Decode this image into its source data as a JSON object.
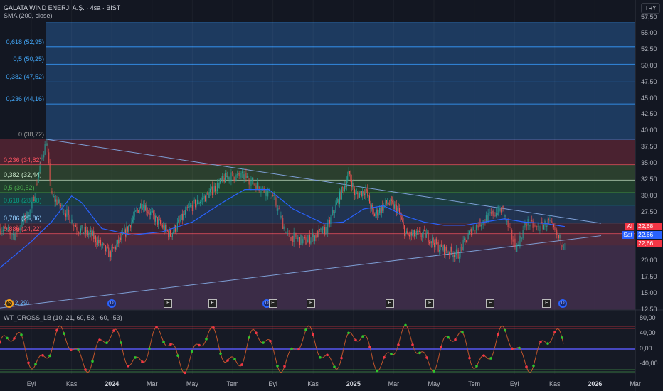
{
  "header": {
    "title": "GALATA WIND ENERJİ A.Ş. · 4sa · BIST",
    "indicator": "SMA (200, close)",
    "currency": "TRY"
  },
  "oscillator": {
    "title": "WT_CROSS_LB (10, 21, 60, 53, -60, -53)",
    "ticks": [
      "80,00",
      "40,00",
      "0,00",
      "-40,00"
    ]
  },
  "price_axis": [
    "57,50",
    "55,00",
    "52,50",
    "50,00",
    "47,50",
    "45,00",
    "42,50",
    "40,00",
    "37,50",
    "35,00",
    "32,50",
    "30,00",
    "27,50",
    "20,00",
    "17,50",
    "15,00",
    "12,50"
  ],
  "price_tags": {
    "buy_label": "Al",
    "buy": "22,68",
    "sell_label": "Sat",
    "sell": "22,66",
    "last": "22,66"
  },
  "time_axis": [
    "Eyl",
    "Kas",
    "2024",
    "Mar",
    "May",
    "Tem",
    "Eyl",
    "Kas",
    "2025",
    "Mar",
    "May",
    "Tem",
    "Eyl",
    "Kas",
    "2026",
    "Mar"
  ],
  "fib_upper": [
    {
      "label": "0,618 (52,95)",
      "v": 52.95
    },
    {
      "label": "0,5 (50,25)",
      "v": 50.25
    },
    {
      "label": "0,382 (47,52)",
      "v": 47.52
    },
    {
      "label": "0,236 (44,16)",
      "v": 44.16
    },
    {
      "label": "0 (38,72)",
      "v": 38.72
    }
  ],
  "fib_lower": [
    {
      "label": "0,236 (34,82)",
      "v": 34.82,
      "c": "#f7525f"
    },
    {
      "label": "0,382 (32,44)",
      "v": 32.44,
      "c": "#c8e6c9"
    },
    {
      "label": "0,5 (30,52)",
      "v": 30.52,
      "c": "#4caf50"
    },
    {
      "label": "0,618 (28,58)",
      "v": 28.58,
      "c": "#089981"
    },
    {
      "label": "0,786 (25,86)",
      "v": 25.86,
      "c": "#90caf9"
    },
    {
      "label": "0,886 (24,22)",
      "v": 24.22,
      "c": "#f7525f"
    },
    {
      "label": "1 (12,29)",
      "v": 12.29,
      "c": "#64b5f6"
    }
  ],
  "events": [
    {
      "t": "S",
      "m": -1.1
    },
    {
      "t": "D",
      "m": 4
    },
    {
      "t": "E",
      "m": 6.8
    },
    {
      "t": "E",
      "m": 9
    },
    {
      "t": "D",
      "m": 11.7
    },
    {
      "t": "E",
      "m": 12
    },
    {
      "t": "E",
      "m": 13.9
    },
    {
      "t": "E",
      "m": 17.8
    },
    {
      "t": "E",
      "m": 19.8
    },
    {
      "t": "E",
      "m": 22.8
    },
    {
      "t": "E",
      "m": 25.6
    },
    {
      "t": "D",
      "m": 26.4
    }
  ],
  "chart_data": {
    "type": "line",
    "title": "GALATA WIND ENERJİ A.Ş. 4sa",
    "x_unit": "months from Sep 2023",
    "ylim": [
      12.5,
      57.5
    ],
    "price": [
      [
        -1.55,
        25
      ],
      [
        -0.85,
        24
      ],
      [
        0,
        28
      ],
      [
        0.4,
        34
      ],
      [
        0.75,
        38.7
      ],
      [
        1,
        30
      ],
      [
        1.6,
        28
      ],
      [
        2.3,
        25
      ],
      [
        3,
        24
      ],
      [
        3.9,
        21
      ],
      [
        4.6,
        24
      ],
      [
        5.5,
        29
      ],
      [
        6,
        27
      ],
      [
        6.9,
        24
      ],
      [
        7.8,
        28
      ],
      [
        8.7,
        30
      ],
      [
        9.7,
        33
      ],
      [
        10.6,
        33
      ],
      [
        11.5,
        31
      ],
      [
        12,
        30
      ],
      [
        12.7,
        24
      ],
      [
        13.6,
        23
      ],
      [
        14.7,
        25
      ],
      [
        15.2,
        29
      ],
      [
        15.8,
        33.5
      ],
      [
        16.1,
        30
      ],
      [
        16.6,
        31
      ],
      [
        17,
        27
      ],
      [
        17.7,
        29
      ],
      [
        18.2,
        28
      ],
      [
        18.6,
        24
      ],
      [
        19.6,
        24
      ],
      [
        20.3,
        22
      ],
      [
        21.2,
        21
      ],
      [
        21.9,
        25
      ],
      [
        22.8,
        27
      ],
      [
        23.4,
        28
      ],
      [
        23.7,
        25
      ],
      [
        24.1,
        22
      ],
      [
        24.6,
        26
      ],
      [
        25.1,
        25
      ],
      [
        25.7,
        26
      ],
      [
        26.2,
        23.5
      ],
      [
        26.5,
        22.66
      ]
    ],
    "sma200": [
      [
        -1.55,
        19
      ],
      [
        0,
        23
      ],
      [
        1,
        26
      ],
      [
        2,
        30
      ],
      [
        2.5,
        29
      ],
      [
        3.5,
        25
      ],
      [
        5,
        24
      ],
      [
        6.5,
        24.5
      ],
      [
        8,
        26
      ],
      [
        9.5,
        29
      ],
      [
        10.6,
        31
      ],
      [
        11.8,
        31
      ],
      [
        13,
        28
      ],
      [
        14.5,
        25.8
      ],
      [
        15.5,
        26
      ],
      [
        16.5,
        28
      ],
      [
        17.5,
        28.5
      ],
      [
        18.5,
        27
      ],
      [
        19.5,
        26
      ],
      [
        20.5,
        25.5
      ],
      [
        21.5,
        25.5
      ],
      [
        22.5,
        26
      ],
      [
        23.5,
        26.5
      ],
      [
        24.5,
        26
      ],
      [
        25.5,
        25.8
      ],
      [
        26.5,
        25.3
      ]
    ]
  }
}
